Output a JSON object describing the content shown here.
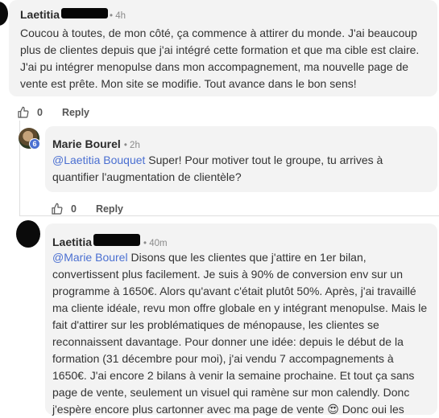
{
  "comments": [
    {
      "author_prefix": "Laetitia",
      "time": "4h",
      "text": "Coucou à toutes, de mon côté, ça commence à attirer du monde. J'ai beaucoup plus de clientes depuis que j'ai intégré cette formation et que ma cible est claire. J'ai pu intégrer menopulse dans mon accompagnement, ma nouvelle page de vente est prête. Mon site se modifie. Tout avance dans le bon sens!",
      "likes": "0",
      "reply_label": "Reply"
    },
    {
      "author": "Marie Bourel",
      "time": "2h",
      "badge": "6",
      "mention": "@Laetitia Bouquet",
      "text": " Super! Pour motiver tout le groupe, tu arrives à quantifier l'augmentation de clientèle?",
      "likes": "0",
      "reply_label": "Reply"
    },
    {
      "author_prefix": "Laetitia",
      "time": "40m",
      "mention": "@Marie Bourel",
      "text": " Disons que les clientes que j'attire en 1er bilan, convertissent plus facilement. Je suis à 90% de conversion env sur un programme à 1650€. Alors qu'avant c'était plutôt 50%. Après, j'ai travaillé ma cliente idéale, revu mon offre globale en y intégrant menopulse. Mais le fait d'attirer sur les problématiques de ménopause, les clientes se reconnaissent davantage. Pour donner une idée: depuis le début de la formation (31 décembre pour moi), j'ai vendu 7 accompagnements à 1650€. J'ai encore 2 bilans à venir la semaine prochaine. Et tout ça sans page de vente, seulement un visuel qui ramène sur mon calendly. Donc j'espère encore plus cartonner avec ma page de vente 😍 Donc oui les filles, cette formation est une pépite!!!! 😍 😍 😍"
    }
  ]
}
